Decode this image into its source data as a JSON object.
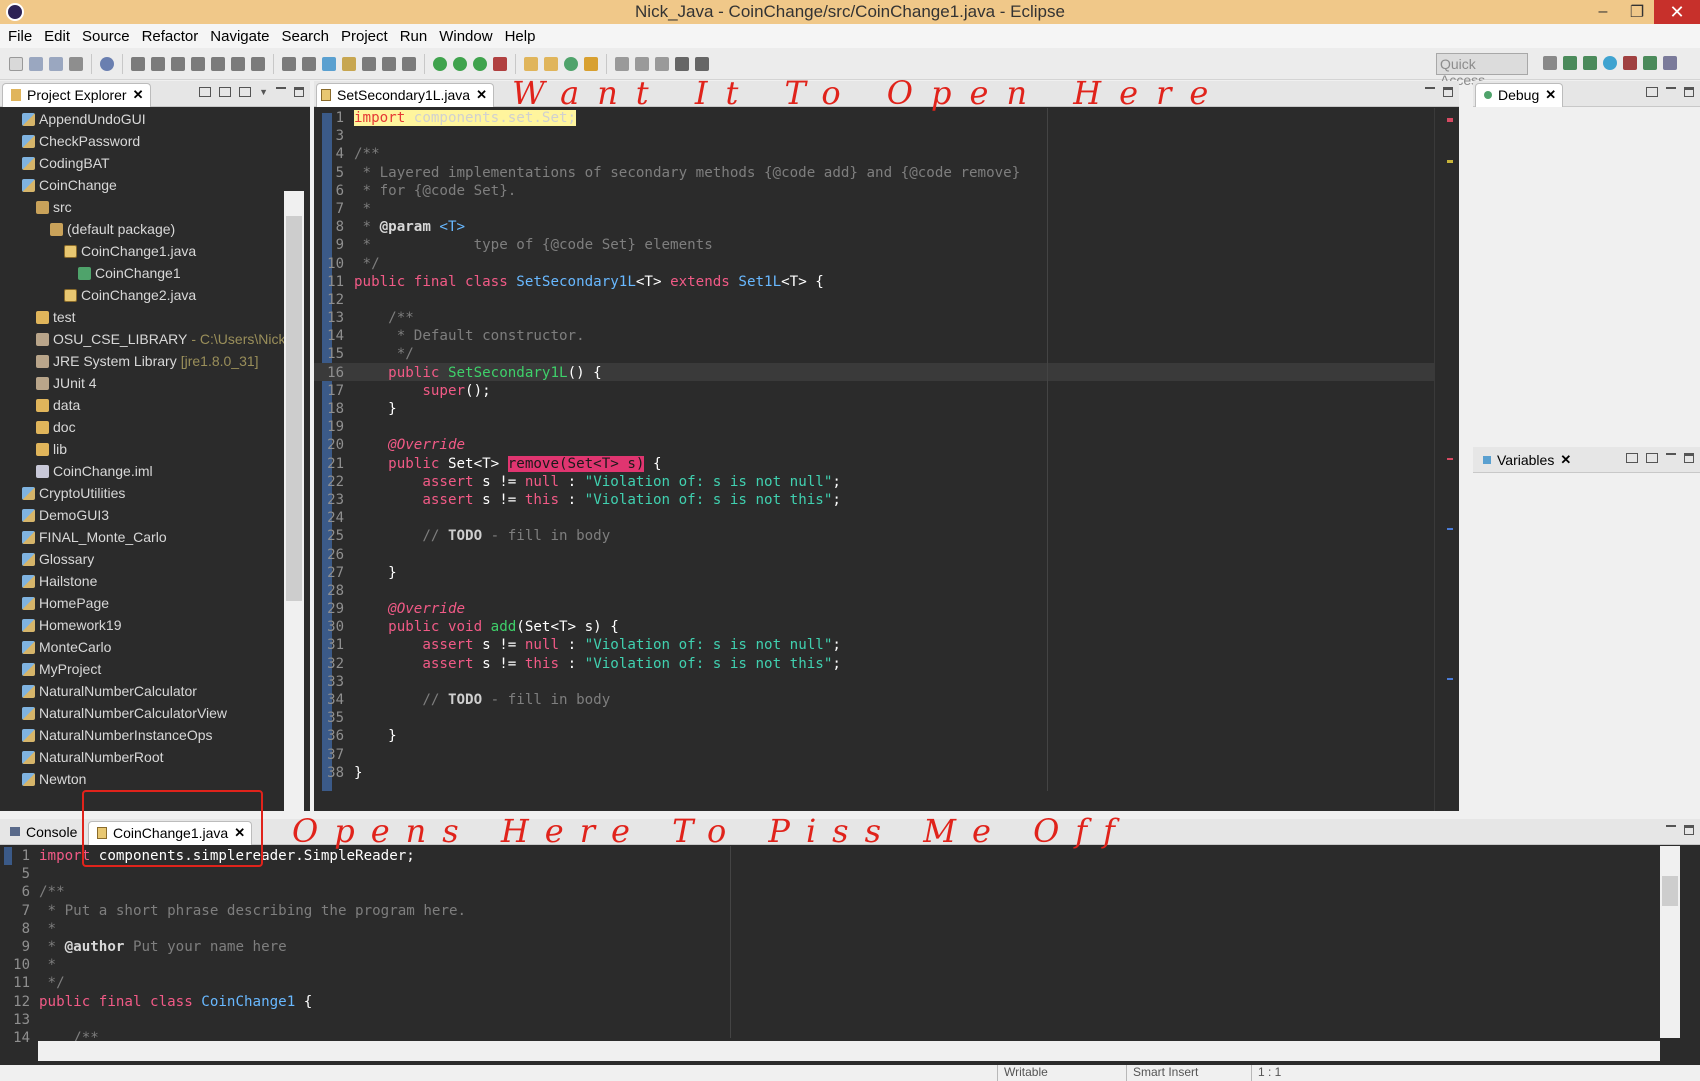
{
  "window": {
    "title": "Nick_Java - CoinChange/src/CoinChange1.java - Eclipse",
    "min": "–",
    "max": "❐",
    "close": "✕"
  },
  "menu": [
    "File",
    "Edit",
    "Source",
    "Refactor",
    "Navigate",
    "Search",
    "Project",
    "Run",
    "Window",
    "Help"
  ],
  "toolbar": {
    "quick_access_placeholder": "Quick Access"
  },
  "explorer": {
    "tab_label": "Project Explorer",
    "close": "✕",
    "rows": [
      {
        "label": "AppendUndoGUI",
        "indent": 0,
        "icon": "proj"
      },
      {
        "label": "CheckPassword",
        "indent": 0,
        "icon": "proj"
      },
      {
        "label": "CodingBAT",
        "indent": 0,
        "icon": "proj"
      },
      {
        "label": "CoinChange",
        "indent": 0,
        "icon": "proj"
      },
      {
        "label": "src",
        "indent": 1,
        "icon": "pkg"
      },
      {
        "label": "(default package)",
        "indent": 2,
        "icon": "pkg"
      },
      {
        "label": "CoinChange1.java",
        "indent": 3,
        "icon": "java"
      },
      {
        "label": "CoinChange1",
        "indent": 4,
        "icon": "class"
      },
      {
        "label": "CoinChange2.java",
        "indent": 3,
        "icon": "java"
      },
      {
        "label": "test",
        "indent": 1,
        "icon": "folder"
      },
      {
        "label": "OSU_CSE_LIBRARY",
        "indent": 1,
        "icon": "lib",
        "dec": "- C:\\Users\\Nick\\De"
      },
      {
        "label": "JRE System Library",
        "indent": 1,
        "icon": "lib",
        "dec": "[jre1.8.0_31]"
      },
      {
        "label": "JUnit 4",
        "indent": 1,
        "icon": "lib"
      },
      {
        "label": "data",
        "indent": 1,
        "icon": "folder"
      },
      {
        "label": "doc",
        "indent": 1,
        "icon": "folder"
      },
      {
        "label": "lib",
        "indent": 1,
        "icon": "folder"
      },
      {
        "label": "CoinChange.iml",
        "indent": 1,
        "icon": "file"
      },
      {
        "label": "CryptoUtilities",
        "indent": 0,
        "icon": "proj"
      },
      {
        "label": "DemoGUI3",
        "indent": 0,
        "icon": "proj"
      },
      {
        "label": "FINAL_Monte_Carlo",
        "indent": 0,
        "icon": "proj"
      },
      {
        "label": "Glossary",
        "indent": 0,
        "icon": "proj"
      },
      {
        "label": "Hailstone",
        "indent": 0,
        "icon": "proj"
      },
      {
        "label": "HomePage",
        "indent": 0,
        "icon": "proj"
      },
      {
        "label": "Homework19",
        "indent": 0,
        "icon": "proj"
      },
      {
        "label": "MonteCarlo",
        "indent": 0,
        "icon": "proj"
      },
      {
        "label": "MyProject",
        "indent": 0,
        "icon": "proj"
      },
      {
        "label": "NaturalNumberCalculator",
        "indent": 0,
        "icon": "proj"
      },
      {
        "label": "NaturalNumberCalculatorView",
        "indent": 0,
        "icon": "proj"
      },
      {
        "label": "NaturalNumberInstanceOps",
        "indent": 0,
        "icon": "proj"
      },
      {
        "label": "NaturalNumberRoot",
        "indent": 0,
        "icon": "proj"
      },
      {
        "label": "Newton",
        "indent": 0,
        "icon": "proj"
      }
    ]
  },
  "editor": {
    "tab_label": "SetSecondary1L.java",
    "close": "✕",
    "line_numbers": [
      "1",
      "3",
      "4",
      "5",
      "6",
      "7",
      "8",
      "9",
      "10",
      "11",
      "12",
      "13",
      "14",
      "15",
      "16",
      "17",
      "18",
      "19",
      "20",
      "21",
      "22",
      "23",
      "24",
      "25",
      "26",
      "27",
      "28",
      "29",
      "30",
      "31",
      "32",
      "33",
      "34",
      "35",
      "36",
      "37",
      "38"
    ],
    "lines": [
      [
        [
          "hl-import",
          "import"
        ],
        [
          "hl-import-rest",
          " components.set.Set;"
        ]
      ],
      [],
      [
        [
          "com",
          "/**"
        ]
      ],
      [
        [
          "com",
          " * Layered implementations of secondary methods {@code add} and {@code remove}"
        ]
      ],
      [
        [
          "com",
          " * for {@code Set}."
        ]
      ],
      [
        [
          "com",
          " *"
        ]
      ],
      [
        [
          "com",
          " * "
        ],
        [
          "tag",
          "@param"
        ],
        [
          "typevar",
          " <T>"
        ]
      ],
      [
        [
          "com",
          " *            type of {@code Set} elements"
        ]
      ],
      [
        [
          "com",
          " */"
        ]
      ],
      [
        [
          "kw",
          "public final class "
        ],
        [
          "typ",
          "SetSecondary1L"
        ],
        [
          "plain",
          "<T> "
        ],
        [
          "kw",
          "extends "
        ],
        [
          "typ",
          "Set1L"
        ],
        [
          "plain",
          "<T> {"
        ]
      ],
      [],
      [
        [
          "com",
          "    /**"
        ]
      ],
      [
        [
          "com",
          "     * Default constructor."
        ]
      ],
      [
        [
          "com",
          "     */"
        ]
      ],
      [
        [
          "kw",
          "    public "
        ],
        [
          "fn",
          "SetSecondary1L"
        ],
        [
          "plain",
          "() {"
        ]
      ],
      [
        [
          "kw",
          "        super"
        ],
        [
          "plain",
          "();"
        ]
      ],
      [
        [
          "plain",
          "    }"
        ]
      ],
      [],
      [
        [
          "ann",
          "    @Override"
        ]
      ],
      [
        [
          "kw",
          "    public "
        ],
        [
          "plain",
          "Set<T> "
        ],
        [
          "hl-remove",
          "remove(Set<T> s)"
        ],
        [
          "plain",
          " {"
        ]
      ],
      [
        [
          "kw",
          "        assert "
        ],
        [
          "plain",
          "s != "
        ],
        [
          "kw",
          "null "
        ],
        [
          "plain",
          ": "
        ],
        [
          "str",
          "\"Violation of: s is not null\""
        ],
        [
          "plain",
          ";"
        ]
      ],
      [
        [
          "kw",
          "        assert "
        ],
        [
          "plain",
          "s != "
        ],
        [
          "kw",
          "this "
        ],
        [
          "plain",
          ": "
        ],
        [
          "str",
          "\"Violation of: s is not this\""
        ],
        [
          "plain",
          ";"
        ]
      ],
      [],
      [
        [
          "com",
          "        // "
        ],
        [
          "todo",
          "TODO"
        ],
        [
          "com",
          " - fill in body"
        ]
      ],
      [],
      [
        [
          "plain",
          "    }"
        ]
      ],
      [],
      [
        [
          "ann",
          "    @Override"
        ]
      ],
      [
        [
          "kw",
          "    public void "
        ],
        [
          "fn",
          "add"
        ],
        [
          "plain",
          "(Set<T> s) {"
        ]
      ],
      [
        [
          "kw",
          "        assert "
        ],
        [
          "plain",
          "s != "
        ],
        [
          "kw",
          "null "
        ],
        [
          "plain",
          ": "
        ],
        [
          "str",
          "\"Violation of: s is not null\""
        ],
        [
          "plain",
          ";"
        ]
      ],
      [
        [
          "kw",
          "        assert "
        ],
        [
          "plain",
          "s != "
        ],
        [
          "kw",
          "this "
        ],
        [
          "plain",
          ": "
        ],
        [
          "str",
          "\"Violation of: s is not this\""
        ],
        [
          "plain",
          ";"
        ]
      ],
      [],
      [
        [
          "com",
          "        // "
        ],
        [
          "todo",
          "TODO"
        ],
        [
          "com",
          " - fill in body"
        ]
      ],
      [],
      [
        [
          "plain",
          "    }"
        ]
      ],
      [],
      [
        [
          "plain",
          "}"
        ]
      ]
    ]
  },
  "debug": {
    "tab_label": "Debug",
    "close": "✕"
  },
  "variables": {
    "tab_label": "Variables",
    "close": "✕"
  },
  "bottom": {
    "console_tab": "Console",
    "file_tab": "CoinChange1.java",
    "close": "✕",
    "line_numbers": [
      "1",
      "5",
      "6",
      "7",
      "8",
      "9",
      "10",
      "11",
      "12",
      "13",
      "14"
    ],
    "lines": [
      [
        [
          "kw",
          "import "
        ],
        [
          "plain",
          "components.simplereader.SimpleReader;"
        ]
      ],
      [],
      [
        [
          "com",
          "/**"
        ]
      ],
      [
        [
          "com",
          " * Put a short phrase describing the program here."
        ]
      ],
      [
        [
          "com",
          " *"
        ]
      ],
      [
        [
          "com",
          " * "
        ],
        [
          "tag",
          "@author"
        ],
        [
          "com",
          " Put your name here"
        ]
      ],
      [
        [
          "com",
          " *"
        ]
      ],
      [
        [
          "com",
          " */"
        ]
      ],
      [
        [
          "kw",
          "public final class "
        ],
        [
          "typ",
          "CoinChange1"
        ],
        [
          "plain",
          " {"
        ]
      ],
      [],
      [
        [
          "com",
          "    /**"
        ]
      ]
    ]
  },
  "annotations": {
    "top": "Want It To Open Here",
    "bottom": "Opens Here To Piss Me Off"
  },
  "status": {
    "writable": "Writable",
    "insert": "Smart Insert",
    "position": "1 : 1"
  },
  "colors": {
    "editor_bg": "#2b2b2b",
    "title_bg": "#f0c889",
    "annotation": "#e0231b"
  }
}
